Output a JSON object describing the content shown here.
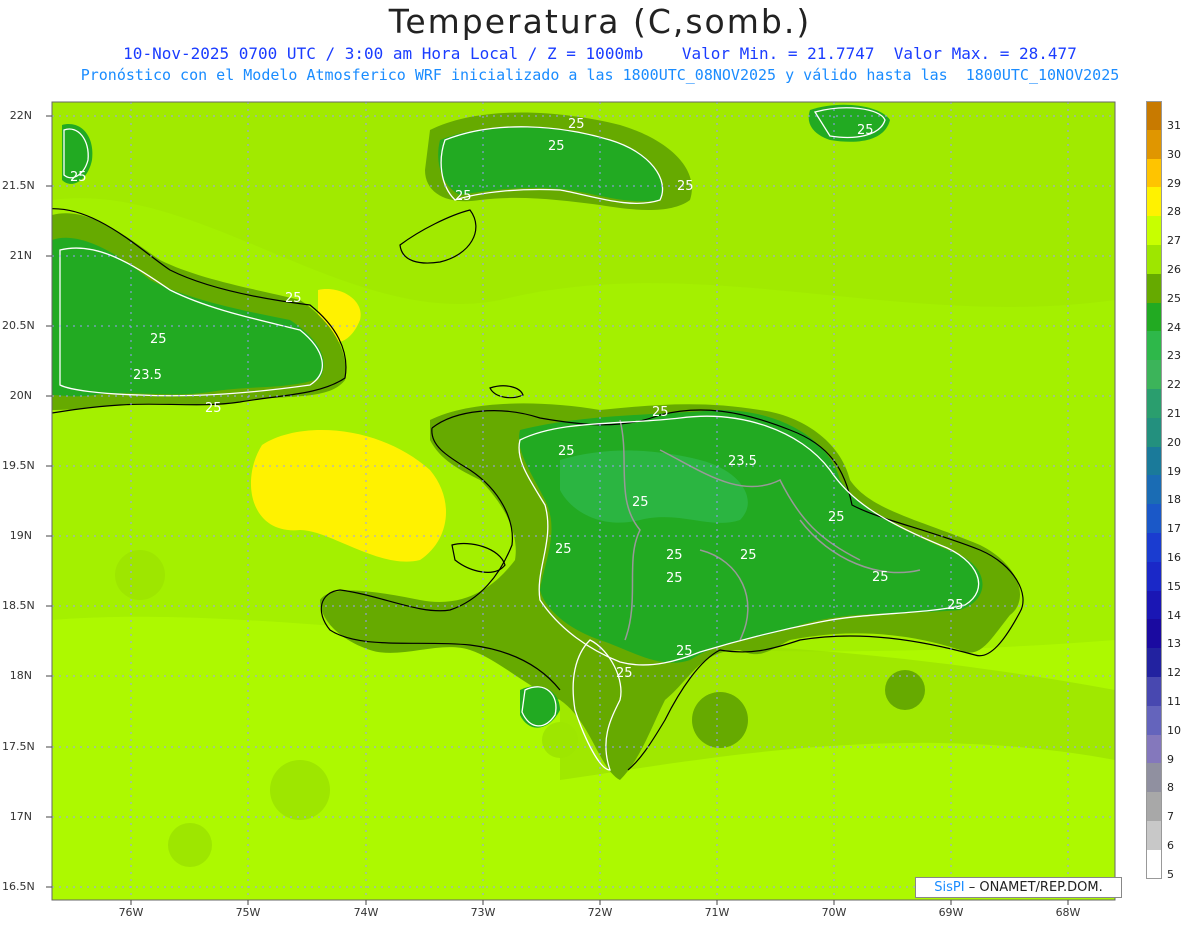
{
  "header": {
    "title": "Temperatura (C,somb.)",
    "line1": "10-Nov-2025 0700 UTC / 3:00 am Hora Local / Z = 1000mb    Valor Min. = 21.7747  Valor Max. = 28.477",
    "line2": "Pronóstico con el Modelo Atmosferico WRF inicializado a las 1800UTC_08NOV2025 y válido hasta las  1800UTC_10NOV2025"
  },
  "axes": {
    "lat_labels": [
      "22N",
      "21.5N",
      "21N",
      "20.5N",
      "20N",
      "19.5N",
      "19N",
      "18.5N",
      "18N",
      "17.5N",
      "17N",
      "16.5N"
    ],
    "lon_labels": [
      "76W",
      "75W",
      "74W",
      "73W",
      "72W",
      "71W",
      "70W",
      "69W",
      "68W"
    ]
  },
  "field": {
    "variable": "Temperatura",
    "units": "C",
    "level": "1000mb",
    "min": 21.7747,
    "max": 28.477,
    "contour_labels": [
      "25",
      "23.5"
    ]
  },
  "colorbar": {
    "labels": [
      "31",
      "30",
      "29",
      "28",
      "27",
      "26",
      "25",
      "24",
      "23",
      "22",
      "21",
      "20",
      "19",
      "18",
      "17",
      "16",
      "15",
      "14",
      "13",
      "12",
      "11",
      "10",
      "9",
      "8",
      "7",
      "6",
      "5"
    ],
    "colors": [
      "#c87a00",
      "#e09600",
      "#ffc400",
      "#fff200",
      "#c8ff00",
      "#9ee600",
      "#66aa00",
      "#22aa22",
      "#2eb84a",
      "#3cb45a",
      "#2a9e6e",
      "#23907e",
      "#1a7a9a",
      "#1a6cb4",
      "#1a58c8",
      "#1a3cd0",
      "#1a28c8",
      "#1a16b4",
      "#1a0aa0",
      "#2222a0",
      "#4848b0",
      "#6464bc",
      "#8478bc",
      "#9090a0",
      "#a8a8a8",
      "#c8c8c8",
      "#ffffff"
    ]
  },
  "credit": {
    "brand": "SisPI",
    "text": "– ONAMET/REP.DOM."
  }
}
